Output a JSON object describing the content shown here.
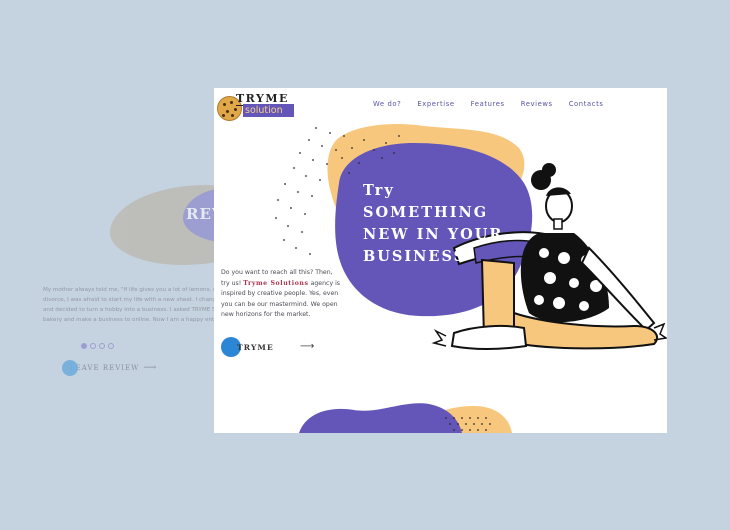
{
  "background_page": {
    "review_title": "REV",
    "testimonial_lines": [
      "My mother always told me, \"If life gives you a lot of lemons, make",
      "divorce, I was afraid to start my life with a new sheet. I changed",
      "and decided to turn a hobby into a business. I asked TRYME S",
      "bakery and make a business to online. Now I am a happy entrepr"
    ],
    "leave_review_label": "LEAVE REVIEW",
    "leave_review_arrow": "⟶"
  },
  "header": {
    "logo_word": "TRYME",
    "logo_sub": "solution",
    "nav": [
      "We do?",
      "Expertise",
      "Features",
      "Reviews",
      "Contacts"
    ]
  },
  "hero": {
    "headline": [
      "Try",
      "something",
      "new in your",
      "business"
    ],
    "para_before": "Do you want to reach all this? Then, try us! ",
    "brand_name": "Tryme Solutions",
    "para_after": " agency is inspired by creative people. Yes, even you can be our mastermind. We open new horizons for the market.",
    "cta_label": "TRYME",
    "cta_arrow": "⟶"
  },
  "colors": {
    "purple": "#6456b8",
    "peach": "#f8c77e",
    "blue": "#2b86d6",
    "page_bg": "#c5d2e0"
  },
  "icons": {
    "cta": "circle-icon",
    "arrow": "arrow-right-icon",
    "logo": "cookie-icon"
  }
}
